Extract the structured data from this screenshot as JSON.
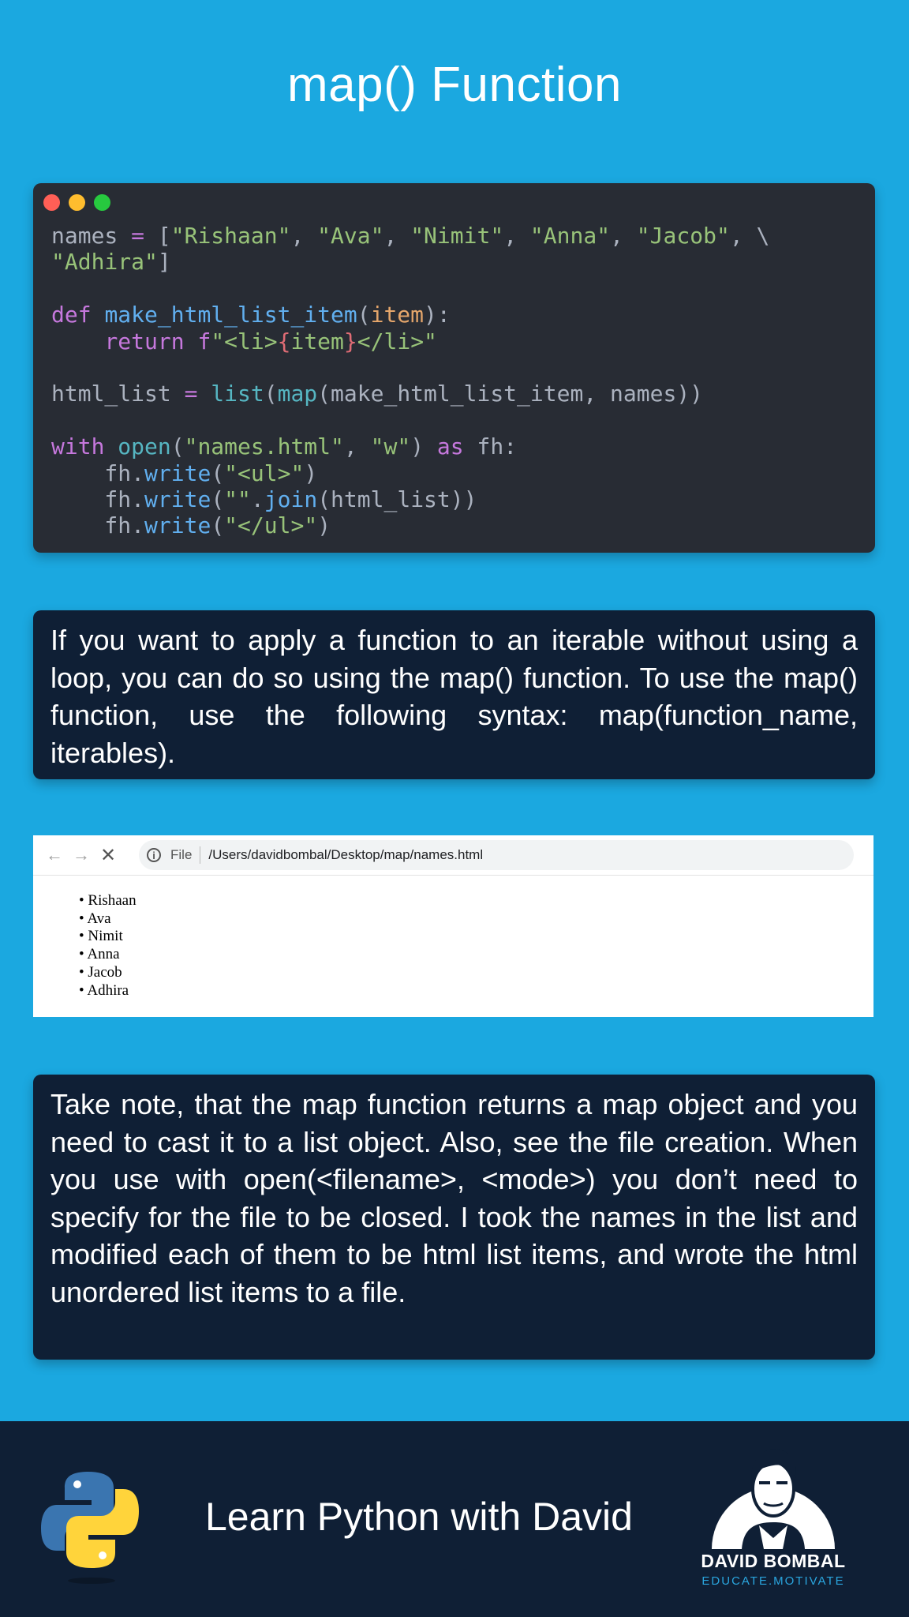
{
  "header": {
    "title": "map() Function"
  },
  "code": {
    "language": "python",
    "lines": [
      "names = [\"Rishaan\", \"Ava\", \"Nimit\", \"Anna\", \"Jacob\", \\",
      "\"Adhira\"]",
      "",
      "def make_html_list_item(item):",
      "    return f\"<li>{item}</li>\"",
      "",
      "html_list = list(map(make_html_list_item, names))",
      "",
      "with open(\"names.html\", \"w\") as fh:",
      "    fh.write(\"<ul>\")",
      "    fh.write(\"\".join(html_list))",
      "    fh.write(\"</ul>\")"
    ]
  },
  "description_1": "If you want to apply a function to  an iterable without using a loop, you can do so  using the map() function. To use the map() function, use the following syntax: map(function_name, iterables).",
  "browser": {
    "back_icon": "←",
    "forward_icon": "→",
    "stop_icon": "✕",
    "info_icon": "i",
    "file_label": "File",
    "url": "/Users/davidbombal/Desktop/map/names.html",
    "list_items": [
      "Rishaan",
      "Ava",
      "Nimit",
      "Anna",
      "Jacob",
      "Adhira"
    ]
  },
  "description_2": "Take note, that the map function returns a map object and you need to cast it to a list object. Also, see the file creation. When you use with open(<filename>, <mode>) you don’t need to specify for the file to be closed. I took the names in the list and modified each of them to be html list items, and wrote the html unordered list items to a file.",
  "footer": {
    "tagline": "Learn Python with David",
    "brand_name": "DAVID BOMBAL",
    "brand_motto": "EDUCATE.MOTIVATE"
  },
  "colors": {
    "background": "#1ba8e0",
    "card": "#0f1f35",
    "code_bg": "#282c34"
  }
}
